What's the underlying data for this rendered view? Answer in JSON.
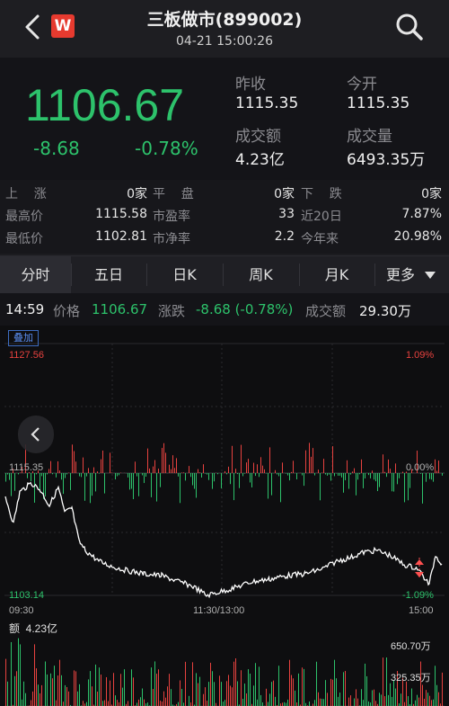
{
  "header": {
    "title": "三板做市(899002)",
    "datetime": "04-21 15:00:26",
    "logo_letter": "W"
  },
  "quote": {
    "price": "1106.67",
    "change": "-8.68",
    "change_pct": "-0.78%",
    "prev_close_label": "昨收",
    "prev_close": "1115.35",
    "open_label": "今开",
    "open": "1115.35",
    "turnover_label": "成交额",
    "turnover": "4.23亿",
    "volume_label": "成交量",
    "volume": "6493.35万"
  },
  "stats": {
    "up_label": "上    涨",
    "up": "0家",
    "flat_label": "平    盘",
    "flat": "0家",
    "down_label": "下    跌",
    "down": "0家",
    "high_label": "最高价",
    "high": "1115.58",
    "pe_label": "市盈率",
    "pe": "33",
    "d20_label": "近20日",
    "d20": "7.87%",
    "low_label": "最低价",
    "low": "1102.81",
    "pb_label": "市净率",
    "pb": "2.2",
    "ytd_label": "今年来",
    "ytd": "20.98%"
  },
  "tabs": [
    "分时",
    "五日",
    "日K",
    "周K",
    "月K",
    "更多"
  ],
  "info": {
    "time": "14:59",
    "price_label": "价格",
    "price": "1106.67",
    "chg_label": "涨跌",
    "chg": "-8.68 (-0.78%)",
    "amt_label": "成交额",
    "amt": "29.30万"
  },
  "chart": {
    "overlay_label": "叠加",
    "y_top": "1127.56",
    "y_top_pct": "1.09%",
    "y_mid": "1115.35",
    "y_mid_pct": "0.00%",
    "y_bot": "1103.14",
    "y_bot_pct": "-1.09%",
    "t_start": "09:30",
    "t_mid": "11:30/13:00",
    "t_end": "15:00",
    "vol_label": "额  4.23亿",
    "vol_top": "650.70万",
    "vol_mid": "325.35万"
  },
  "colors": {
    "up": "#e8423f",
    "down": "#2dc26b",
    "line": "#ffffff",
    "accent": "#e63a2f"
  },
  "icons": {
    "back": "back-chevron-icon",
    "search": "search-icon",
    "collapse": "chevron-left-icon",
    "more": "triangle-down-icon"
  }
}
